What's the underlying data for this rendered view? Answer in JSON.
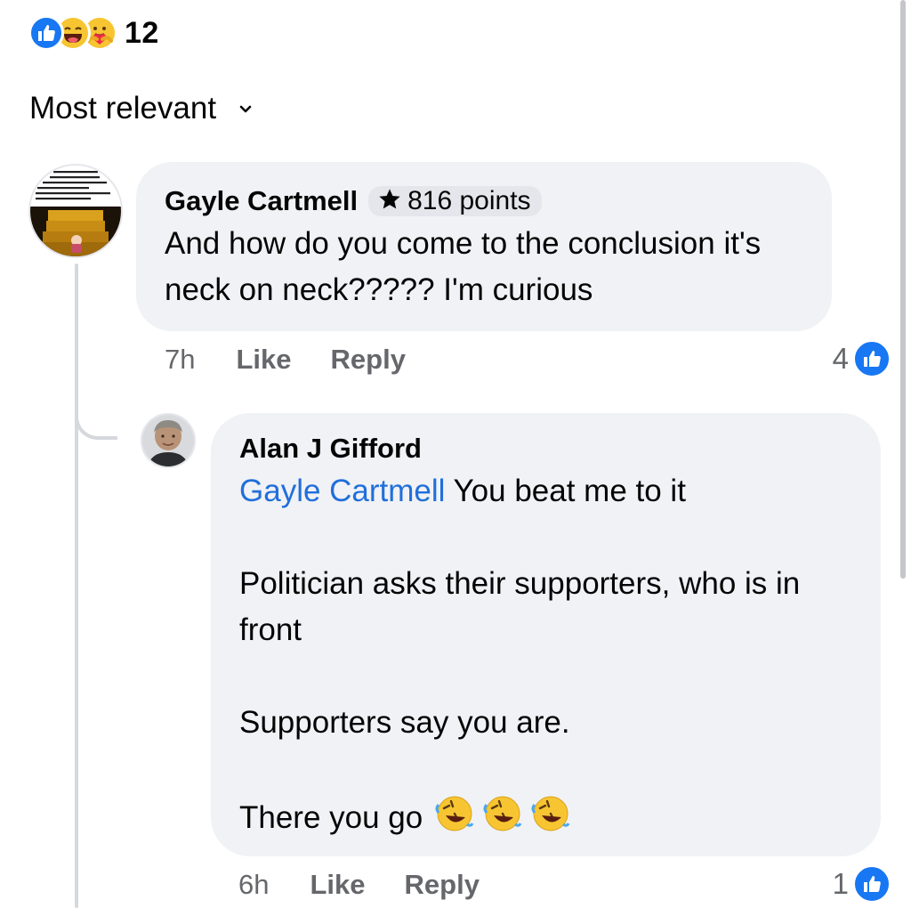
{
  "reactions": {
    "icons": [
      "like-icon",
      "haha-icon",
      "care-icon"
    ],
    "count": "12",
    "colors": {
      "like": "#1877f2",
      "emoji": "#f7c531"
    }
  },
  "sort": {
    "label": "Most relevant",
    "icon": "chevron-down-icon"
  },
  "comments": [
    {
      "author": "Gayle Cartmell",
      "badge": "816 points",
      "badge_icon": "star-icon",
      "text": "And how do you come to the conclusion it's neck on neck????? I'm curious",
      "time": "7h",
      "like_label": "Like",
      "reply_label": "Reply",
      "reaction_count": "4"
    },
    {
      "author": "Alan J Gifford",
      "mention": "Gayle Cartmell",
      "text_lines": [
        " You beat me to it",
        "Politician asks their supporters, who is in front",
        "Supporters say you are.",
        "There you go"
      ],
      "time": "6h",
      "like_label": "Like",
      "reply_label": "Reply",
      "reaction_count": "1"
    }
  ],
  "colors": {
    "link": "#216fdb",
    "bubble": "#f0f2f5",
    "meta": "#65676b"
  }
}
